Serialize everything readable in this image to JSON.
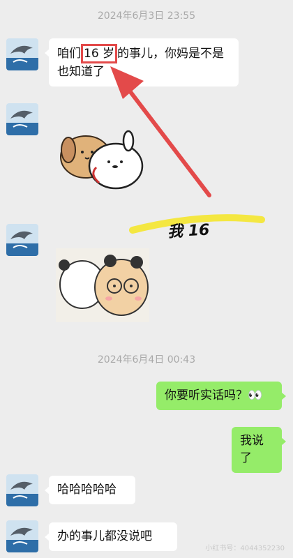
{
  "colors": {
    "background": "#ededed",
    "bubble_in": "#ffffff",
    "bubble_out": "#95ec69",
    "timestamp": "#a9a9a9",
    "annotation_red": "#e34a4a",
    "highlighter": "#f4e62e"
  },
  "timestamps": [
    "2024年6月3日 23:55",
    "2024年6月4日 00:43"
  ],
  "messages": {
    "m1_before": "咱们",
    "m1_highlight": "16 岁",
    "m1_after": "的事儿，你妈是不是也知道了",
    "m4": "你要听实话吗？👀",
    "m5": "我说了",
    "m6": "哈哈哈哈哈",
    "m7": "办的事儿都没说吧"
  },
  "annotation": {
    "text": "我 16"
  },
  "stickers": [
    "dog-hugging-sticker",
    "bear-and-bun-sticker"
  ],
  "avatar_icon": "dolphin-avatar-icon",
  "watermark": "小红书号：4044352230"
}
